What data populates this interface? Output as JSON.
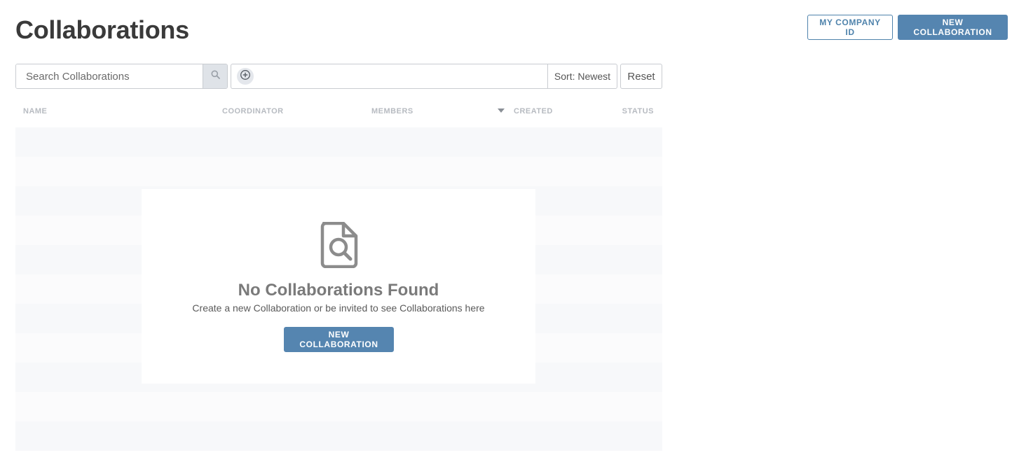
{
  "header": {
    "title": "Collaborations",
    "my_company_id_label": "MY COMPANY ID",
    "new_collaboration_label": "NEW COLLABORATION"
  },
  "toolbar": {
    "search_placeholder": "Search Collaborations",
    "search_icon": "search-icon",
    "add_filter_icon": "plus-circle-icon",
    "sort_label": "Sort: Newest",
    "reset_label": "Reset"
  },
  "table": {
    "columns": [
      "NAME",
      "COORDINATOR",
      "MEMBERS",
      "CREATED",
      "STATUS"
    ],
    "sort_indicator_icon": "caret-down-icon"
  },
  "empty_state": {
    "icon": "document-search-icon",
    "title": "No Collaborations Found",
    "message": "Create a new Collaboration or be invited to see Collaborations here",
    "action_label": "NEW COLLABORATION"
  },
  "colors": {
    "primary": "#5585b0",
    "outline": "#4f83ac",
    "header_text": "#b7bbc1",
    "title": "#3a3a3a",
    "empty_icon": "#8c8c8c"
  }
}
